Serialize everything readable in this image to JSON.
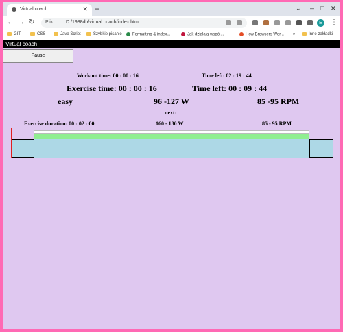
{
  "browser": {
    "tab_title": "Virtual coach",
    "address_info": "Plik",
    "url": "D:/1988db/virtual.coach/index.html",
    "profile_initial": "E",
    "bookmarks": [
      {
        "label": "GIT",
        "kind": "folder"
      },
      {
        "label": "CSS",
        "kind": "folder"
      },
      {
        "label": "Java Script",
        "kind": "folder"
      },
      {
        "label": "Szybkie pisanie",
        "kind": "folder"
      },
      {
        "label": "Formatting & index...",
        "kind": "site",
        "color": "#2a8a4a"
      },
      {
        "label": "Jak działają współ...",
        "kind": "site",
        "color": "#c0143c"
      },
      {
        "label": "How Browsers Wor...",
        "kind": "site",
        "color": "#e44d26"
      }
    ],
    "more_bookmarks": "»",
    "other_bookmarks": "Inne zakładki"
  },
  "app": {
    "title": "Virtual coach",
    "pause_label": "Pause",
    "workout_time": "Workout time: 00 : 00 : 16",
    "workout_time_left": "Time left: 02 : 19 : 44",
    "exercise_time": "Exercise time: 00 : 00 : 16",
    "exercise_time_left": "Time left: 00 : 09 : 44",
    "current": {
      "intensity": "easy",
      "power": "96 -127 W",
      "cadence": "85 -95 RPM"
    },
    "next_label": "next:",
    "next": {
      "duration": "Exercise duration: 00 : 02 : 00",
      "power": "160 - 180 W",
      "cadence": "85 - 95 RPM"
    }
  },
  "colors": {
    "page_bg": "#dfc8f0",
    "target_band": "#90ee90",
    "zone": "#add8e6",
    "progress_marker": "#e02020"
  }
}
